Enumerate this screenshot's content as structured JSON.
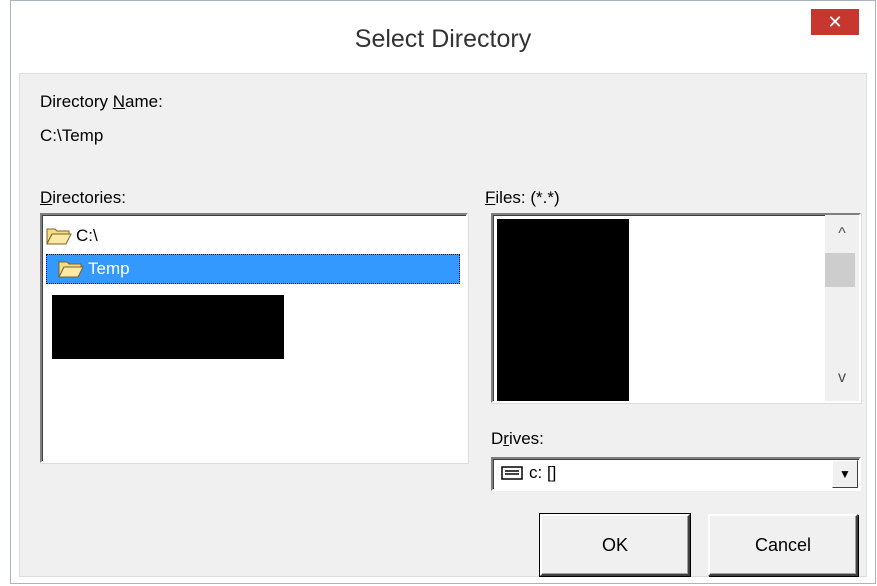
{
  "window": {
    "title": "Select Directory",
    "close_label": "✕"
  },
  "dirname": {
    "label_pre": "Directory ",
    "label_u": "N",
    "label_post": "ame:",
    "value": "C:\\Temp"
  },
  "directories": {
    "label_u": "D",
    "label_post": "irectories:",
    "items": [
      {
        "label": "C:\\",
        "selected": false
      },
      {
        "label": "Temp",
        "selected": true
      }
    ]
  },
  "files": {
    "label_u": "F",
    "label_post": "iles: (*.*)",
    "scroll_up": "^",
    "scroll_down": "v"
  },
  "drives": {
    "label_pre": "D",
    "label_u": "r",
    "label_post": "ives:",
    "selected": "c: []"
  },
  "buttons": {
    "ok": "OK",
    "cancel": "Cancel"
  },
  "colors": {
    "selection": "#3399ff",
    "close": "#c7372f",
    "dialog_bg": "#f0f0f0"
  }
}
